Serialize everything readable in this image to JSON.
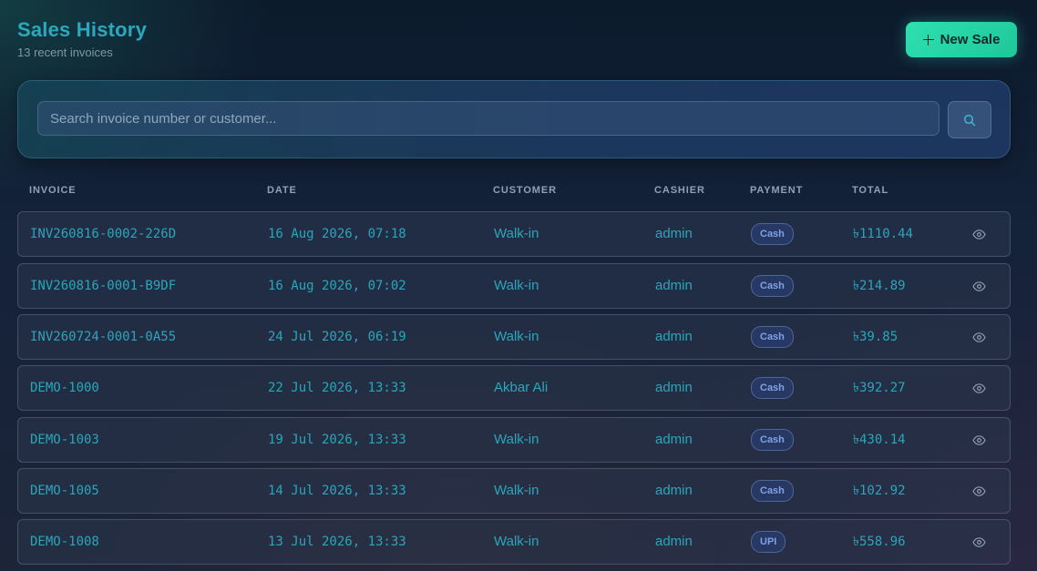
{
  "header": {
    "title": "Sales History",
    "subtitle": "13 recent invoices",
    "new_sale_label": "New Sale"
  },
  "search": {
    "placeholder": "Search invoice number or customer..."
  },
  "table": {
    "columns": [
      "INVOICE",
      "DATE",
      "CUSTOMER",
      "CASHIER",
      "PAYMENT",
      "TOTAL"
    ],
    "rows": [
      {
        "invoice": "INV260816-0002-226D",
        "date": "16 Aug 2026, 07:18",
        "customer": "Walk-in",
        "cashier": "admin",
        "payment": "Cash",
        "total": "৳1110.44"
      },
      {
        "invoice": "INV260816-0001-B9DF",
        "date": "16 Aug 2026, 07:02",
        "customer": "Walk-in",
        "cashier": "admin",
        "payment": "Cash",
        "total": "৳214.89"
      },
      {
        "invoice": "INV260724-0001-0A55",
        "date": "24 Jul 2026, 06:19",
        "customer": "Walk-in",
        "cashier": "admin",
        "payment": "Cash",
        "total": "৳39.85"
      },
      {
        "invoice": "DEMO-1000",
        "date": "22 Jul 2026, 13:33",
        "customer": "Akbar Ali",
        "cashier": "admin",
        "payment": "Cash",
        "total": "৳392.27"
      },
      {
        "invoice": "DEMO-1003",
        "date": "19 Jul 2026, 13:33",
        "customer": "Walk-in",
        "cashier": "admin",
        "payment": "Cash",
        "total": "৳430.14"
      },
      {
        "invoice": "DEMO-1005",
        "date": "14 Jul 2026, 13:33",
        "customer": "Walk-in",
        "cashier": "admin",
        "payment": "Cash",
        "total": "৳102.92"
      },
      {
        "invoice": "DEMO-1008",
        "date": "13 Jul 2026, 13:33",
        "customer": "Walk-in",
        "cashier": "admin",
        "payment": "UPI",
        "total": "৳558.96"
      }
    ]
  },
  "icons": {
    "new_sale": "plus-icon",
    "search": "search-icon",
    "row_action": "eye-icon"
  },
  "colors": {
    "accent": "#2ee0b0",
    "text_teal": "#2aa6bb",
    "badge_text": "#7fa2e6"
  }
}
